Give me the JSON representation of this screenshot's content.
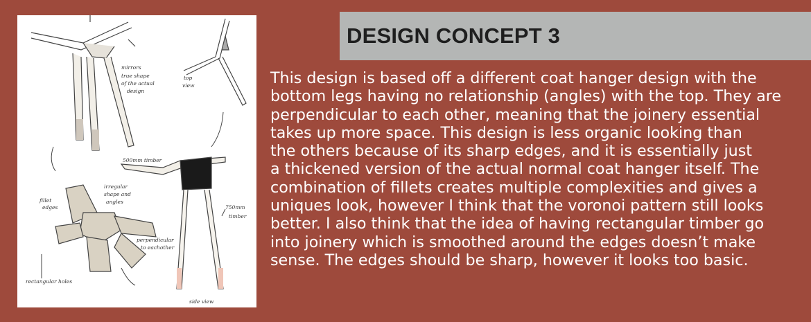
{
  "title": "DESIGN CONCEPT 3",
  "paragraph_lines": [
    "This design is based off a different coat hanger design with the",
    "bottom legs having no relationship (angles) with the top. They are",
    "perpendicular to each other, meaning that the joinery essential",
    "takes up more space. This design is less organic looking than",
    "the others because of its sharp edges, and it is essentially just",
    "a thickened version of the actual normal coat hanger itself. The",
    "combination of fillets creates multiple complexities and gives a",
    "uniques look, however I think that the voronoi pattern still looks",
    "better. I also think that the idea of having rectangular timber go",
    "into joinery which is smoothed around the edges doesn’t make",
    "sense. The edges should be sharp, however it looks too basic."
  ],
  "sketch": {
    "annotations": {
      "mirrors": "mirrors",
      "true_shape": "true shape",
      "of_the_actual": "of the actual",
      "design": "design",
      "top": "top",
      "view": "view",
      "timber_500": "500mm timber",
      "irregular": "irregular",
      "shape_and": "shape and",
      "angles": "angles",
      "fillet": "fillet",
      "edges": "edges",
      "timber_750": "750mm",
      "timber": "timber",
      "perpendicular": "perpendicular",
      "to_eachother": "to eachother",
      "rectangular_holes": "rectangular holes",
      "side_view": "side view"
    }
  }
}
